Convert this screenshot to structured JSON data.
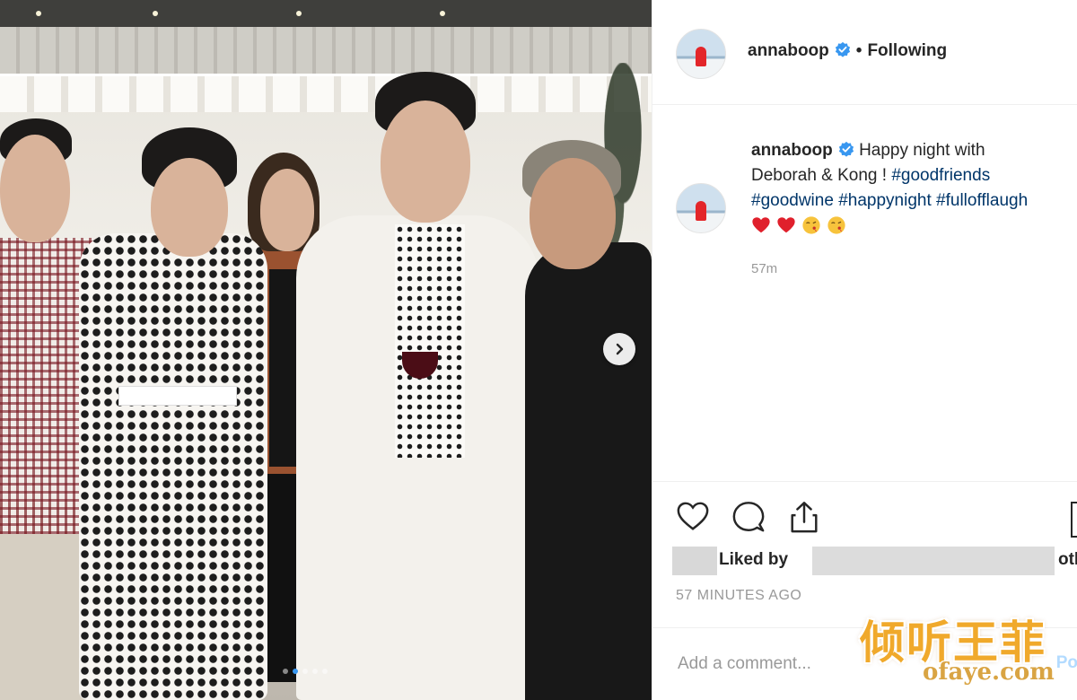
{
  "post": {
    "username": "annaboop",
    "separator": "•",
    "follow_status": "Following",
    "caption_line1": "Happy night with",
    "caption_line2_text": "Deborah & Kong ! ",
    "caption_line2_tag": "#goodfriends",
    "caption_tags_line3": [
      "#goodwine",
      "#happynight",
      "#fullofflaugh"
    ],
    "emojis": [
      "heart",
      "heart",
      "kiss",
      "kiss"
    ],
    "caption_time": "57m",
    "liked_by_prefix": "Liked by",
    "liked_by_suffix": "othe",
    "post_time": "57 MINUTES AGO",
    "comment_placeholder": "Add a comment...",
    "post_button": "Po"
  },
  "carousel": {
    "total": 5,
    "active_index": 1
  },
  "watermark": {
    "cn": "倾听王菲",
    "en": "ofaye.com"
  },
  "colors": {
    "verified": "#3897f0",
    "hashtag": "#003569",
    "heart": "#e0202c",
    "accent": "#3897f0"
  }
}
